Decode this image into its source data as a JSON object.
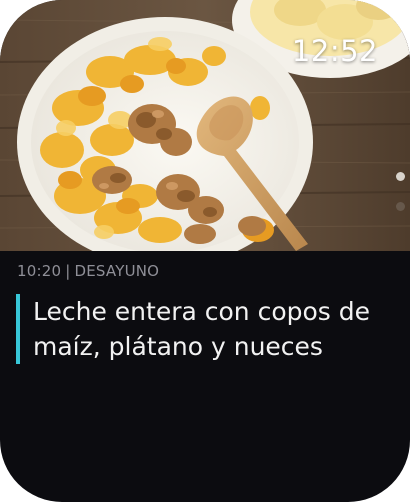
{
  "status": {
    "time": "12:52"
  },
  "meal": {
    "time": "10:20",
    "separator": "|",
    "category": "DESAYUNO",
    "title": "Leche entera con copos de maíz, plátano y nueces"
  },
  "pager": {
    "pages": 2,
    "active_index": 0
  },
  "colors": {
    "accent": "#38c7d8",
    "background": "#0c0c10",
    "meta_text": "#8f8f97",
    "title_text": "#f2f2f2"
  }
}
